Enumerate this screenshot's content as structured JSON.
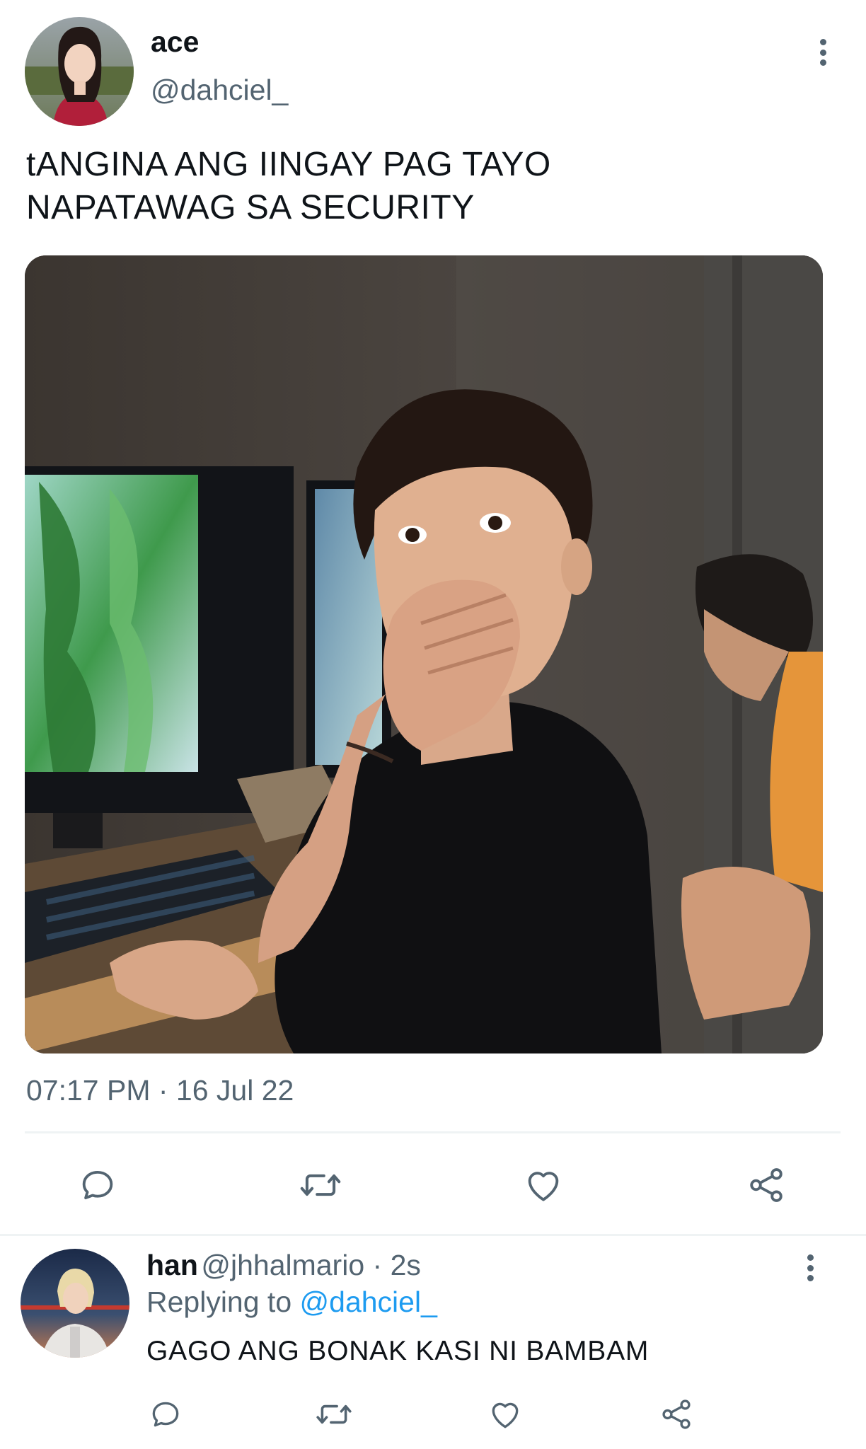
{
  "tweet": {
    "display_name": "ace",
    "handle": "@dahciel_",
    "text_line1": "tANGINA ANG IINGAY PAG TAYO",
    "text_line2": "NAPATAWAG SA SECURITY",
    "timestamp": "07:17 PM · 16 Jul 22"
  },
  "actions": [
    "reply-icon",
    "retweet-icon",
    "like-icon",
    "share-icon"
  ],
  "reply": {
    "display_name": "han",
    "handle": "@jhhalmario",
    "separator": " · ",
    "time": "2s",
    "replying_prefix": "Replying to ",
    "replying_mention": "@dahciel_",
    "text": "GAGO ANG BONAK KASI NI BAMBAM"
  },
  "colors": {
    "text": "#0f1419",
    "secondary": "#536471",
    "accent": "#1d9bf0",
    "divider": "#eff3f4"
  }
}
